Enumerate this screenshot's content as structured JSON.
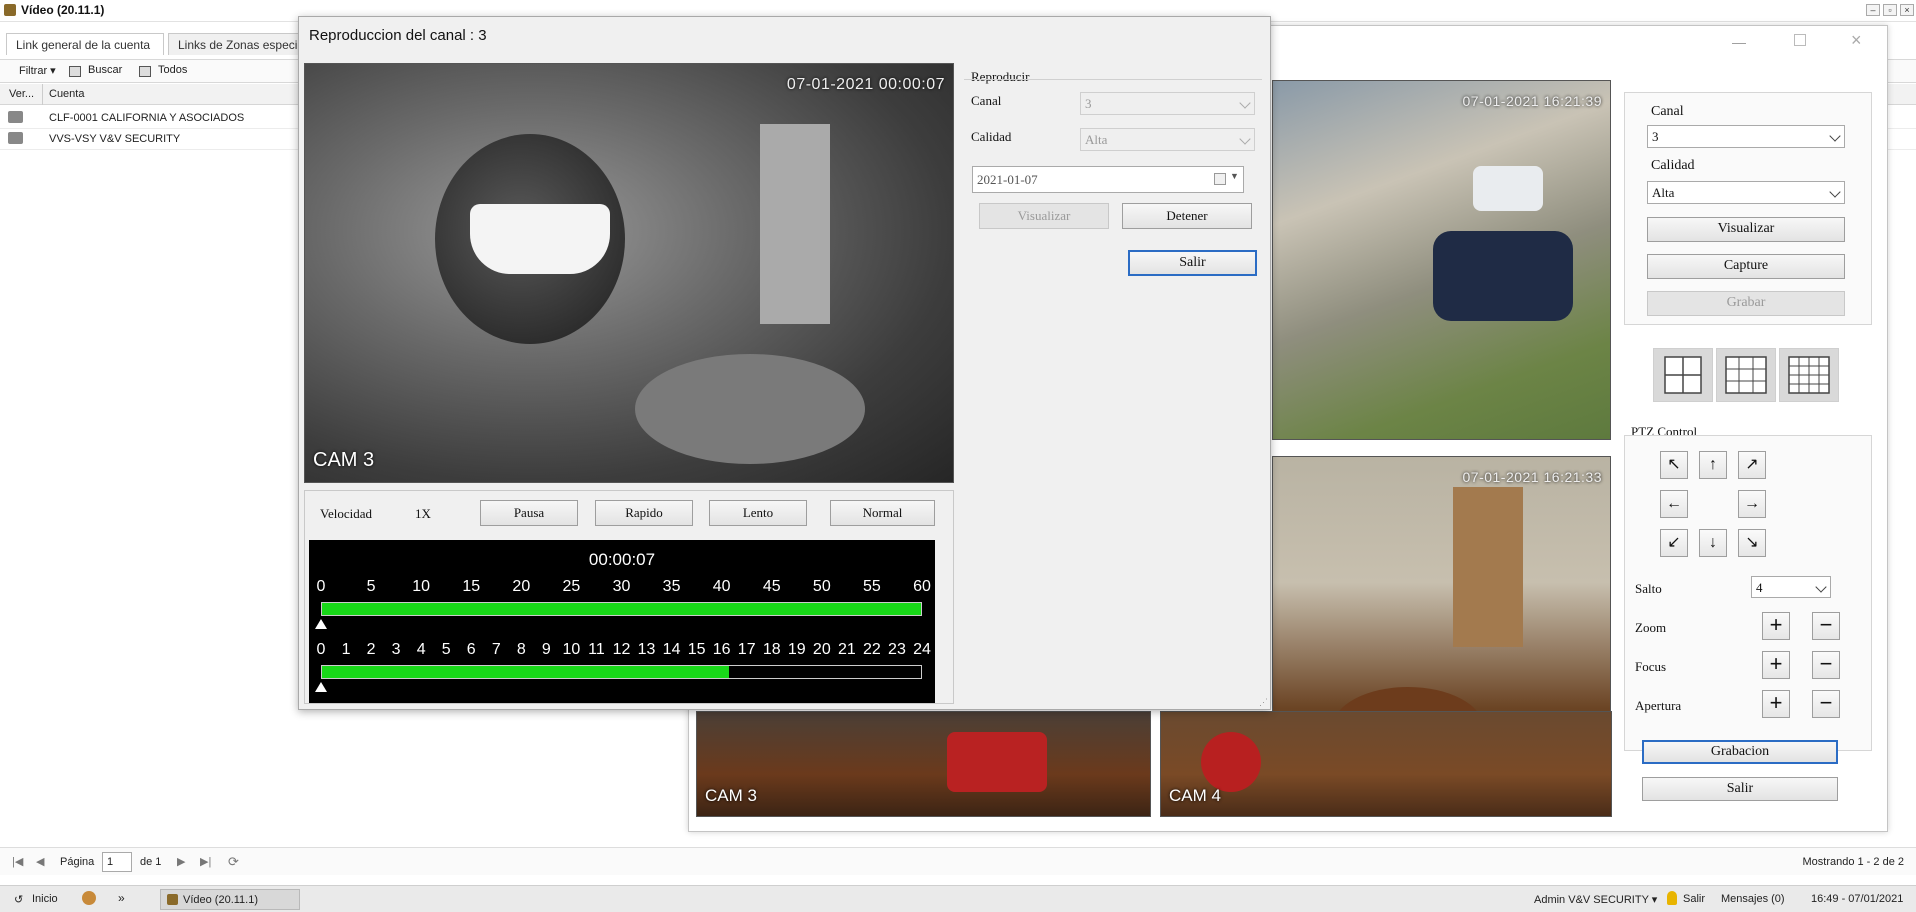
{
  "app": {
    "title": "Vídeo (20.11.1)"
  },
  "tabs": [
    "Link general de la cuenta",
    "Links de Zonas especi"
  ],
  "toolbar": {
    "filter": "Filtrar",
    "search": "Buscar",
    "all": "Todos"
  },
  "grid": {
    "headers": [
      "Ver...",
      "Cuenta"
    ],
    "rows": [
      {
        "account": "CLF-0001 CALIFORNIA Y ASOCIADOS"
      },
      {
        "account": "VVS-VSY V&V SECURITY"
      }
    ]
  },
  "pager": {
    "page_label": "Página",
    "page": "1",
    "of": "de 1",
    "showing": "Mostrando 1 - 2 de 2"
  },
  "taskbar": {
    "start": "Inicio",
    "app": "Vídeo (20.11.1)",
    "user": "Admin V&V SECURITY",
    "logout": "Salir",
    "messages": "Mensajes (0)",
    "clock": "16:49 - 07/01/2021"
  },
  "live": {
    "cams": [
      {
        "label": "",
        "timestamp": "07-01-2021 16:21:39"
      },
      {
        "label": "",
        "timestamp": "07-01-2021 16:21:33"
      },
      {
        "label": "CAM 3",
        "timestamp": ""
      },
      {
        "label": "CAM 4",
        "timestamp": ""
      }
    ],
    "channel_label": "Canal",
    "channel": "3",
    "quality_label": "Calidad",
    "quality": "Alta",
    "view_btn": "Visualizar",
    "capture_btn": "Capture",
    "record_btn": "Grabar",
    "ptz_title": "PTZ Control",
    "jump_label": "Salto",
    "jump": "4",
    "zoom_label": "Zoom",
    "focus_label": "Focus",
    "aperture_label": "Apertura",
    "recording_btn": "Grabacion",
    "exit_btn": "Salir"
  },
  "playback": {
    "title": "Reproduccion del canal : 3",
    "cam_label": "CAM 3",
    "cam_timestamp": "07-01-2021 00:00:07",
    "group_label": "Reproducir",
    "channel_label": "Canal",
    "channel": "3",
    "quality_label": "Calidad",
    "quality": "Alta",
    "date": "2021-01-07",
    "view_btn": "Visualizar",
    "stop_btn": "Detener",
    "exit_btn": "Salir",
    "speed_label": "Velocidad",
    "speed": "1X",
    "pause_btn": "Pausa",
    "fast_btn": "Rapido",
    "slow_btn": "Lento",
    "normal_btn": "Normal",
    "time": "00:00:07",
    "minute_ticks": [
      "0",
      "5",
      "10",
      "15",
      "20",
      "25",
      "30",
      "35",
      "40",
      "45",
      "50",
      "55",
      "60"
    ],
    "hour_ticks": [
      "0",
      "1",
      "2",
      "3",
      "4",
      "5",
      "6",
      "7",
      "8",
      "9",
      "10",
      "11",
      "12",
      "13",
      "14",
      "15",
      "16",
      "17",
      "18",
      "19",
      "20",
      "21",
      "22",
      "23",
      "24"
    ],
    "minute_bar_fill": 1.0,
    "hour_bar_fill": 0.68
  },
  "colors": {
    "accent": "#2b6cc4",
    "bar": "#18d818"
  }
}
